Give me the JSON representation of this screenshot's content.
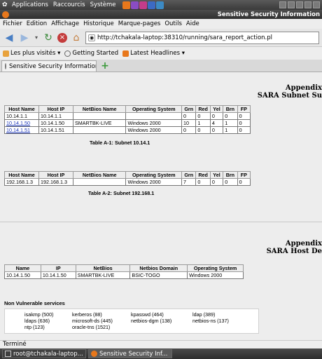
{
  "top_panel": {
    "menus": [
      "Applications",
      "Raccourcis",
      "Système"
    ],
    "launcher_colors": [
      "#e8781c",
      "#8a4cc4",
      "#c43c8a",
      "#3c6ac4"
    ]
  },
  "window": {
    "title": "Sensitive Security Information"
  },
  "menubar": {
    "items": [
      "Fichier",
      "Edition",
      "Affichage",
      "Historique",
      "Marque-pages",
      "Outils",
      "Aide"
    ]
  },
  "navbar": {
    "url": "http://tchakala-laptop:38310/running/sara_report_action.pl"
  },
  "bookmarks": {
    "items": [
      "Les plus visités ▾",
      "Getting Started",
      "Latest Headlines ▾"
    ]
  },
  "tab": {
    "label": "Sensitive Security Information"
  },
  "report": {
    "appendix_a": {
      "line1": "Appendix",
      "line2": "SARA Subnet Su"
    },
    "subnet_headers": [
      "Host Name",
      "Host IP",
      "NetBios Name",
      "Operating System",
      "Grn",
      "Red",
      "Yel",
      "Brn",
      "FP"
    ],
    "subnet1": {
      "rows": [
        [
          "10.14.1.1",
          "10.14.1.1",
          "",
          "",
          "0",
          "0",
          "0",
          "0",
          "0"
        ],
        [
          "10.14.1.50",
          "10.14.1.50",
          "SMARTBK-LIVE",
          "Windows 2000",
          "10",
          "1",
          "4",
          "1",
          "0"
        ],
        [
          "10.14.1.51",
          "10.14.1.51",
          "",
          "Windows 2000",
          "0",
          "0",
          "0",
          "1",
          "0"
        ]
      ],
      "caption": "Table A-1: Subnet 10.14.1"
    },
    "subnet2": {
      "rows": [
        [
          "192.168.1.3",
          "192.168.1.3",
          "",
          "Windows 2000",
          "7",
          "0",
          "0",
          "0",
          "0"
        ]
      ],
      "caption": "Table A-2: Subnet 192.168.1"
    },
    "appendix_b": {
      "line1": "Appendix",
      "line2": "SARA Host De"
    },
    "host_headers": [
      "Name",
      "IP",
      "NetBios",
      "Netbios Domain",
      "Operating System"
    ],
    "host_row": [
      "10.14.1.50",
      "10.14.1.50",
      "SMARTBK-LIVE",
      "BSIC-TOGO",
      "Windows 2000"
    ],
    "non_vuln_title": "Non Vulnerable services",
    "services": [
      [
        "isakmp (500)",
        "ldaps (636)",
        "ntp (123)"
      ],
      [
        "kerberos (88)",
        "microsoft-ds (445)",
        "oracle-tns (1521)"
      ],
      [
        "kpasswd (464)",
        "netbios-dgm (138)"
      ],
      [
        "ldap (389)",
        "netbios-ns (137)"
      ]
    ]
  },
  "statusbar": {
    "text": "Terminé"
  },
  "taskbar": {
    "items": [
      "root@tchakala-laptop...",
      "Sensitive Security Inf..."
    ]
  }
}
